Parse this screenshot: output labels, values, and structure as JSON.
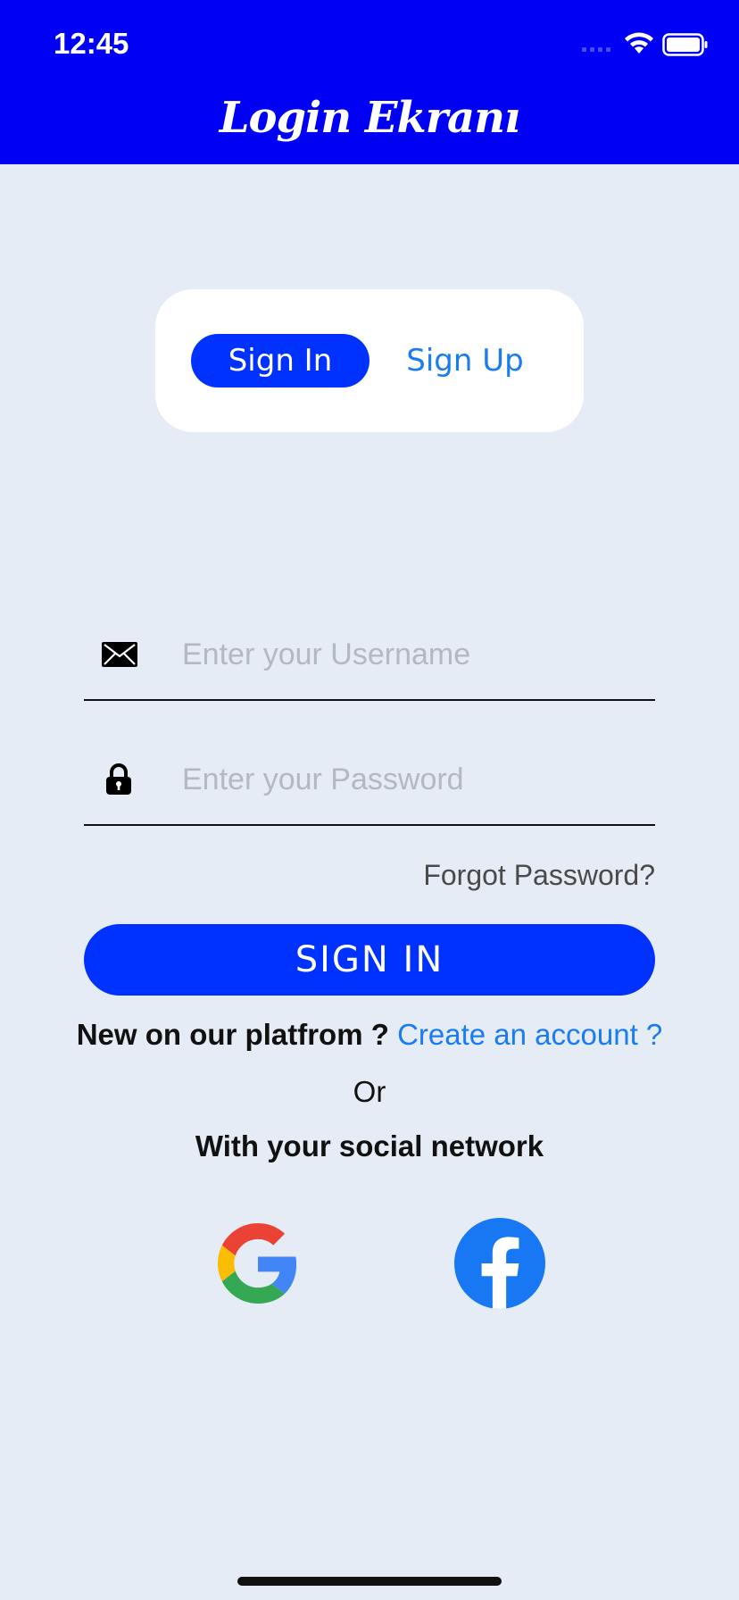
{
  "status_bar": {
    "time": "12:45",
    "icons": [
      "cellular-dots-icon",
      "wifi-icon",
      "battery-icon"
    ]
  },
  "header": {
    "title": "Login Ekranı",
    "background": "#0000f5"
  },
  "segment": {
    "active_label": "Sign In",
    "inactive_label": "Sign Up"
  },
  "form": {
    "username_placeholder": "Enter your Username",
    "password_placeholder": "Enter your Password",
    "username_icon": "envelope-icon",
    "password_icon": "lock-icon",
    "forgot_label": "Forgot Password?",
    "submit_label": "SIGN IN"
  },
  "footer": {
    "new_question": "New on our platfrom ?",
    "create_link": "Create an account ?",
    "or_label": "Or",
    "social_label": "With your social network",
    "social_icons": [
      "google-icon",
      "facebook-icon"
    ]
  },
  "colors": {
    "accent": "#0032ff",
    "link": "#1a7cf0",
    "page_background": "#e5ecf5"
  }
}
